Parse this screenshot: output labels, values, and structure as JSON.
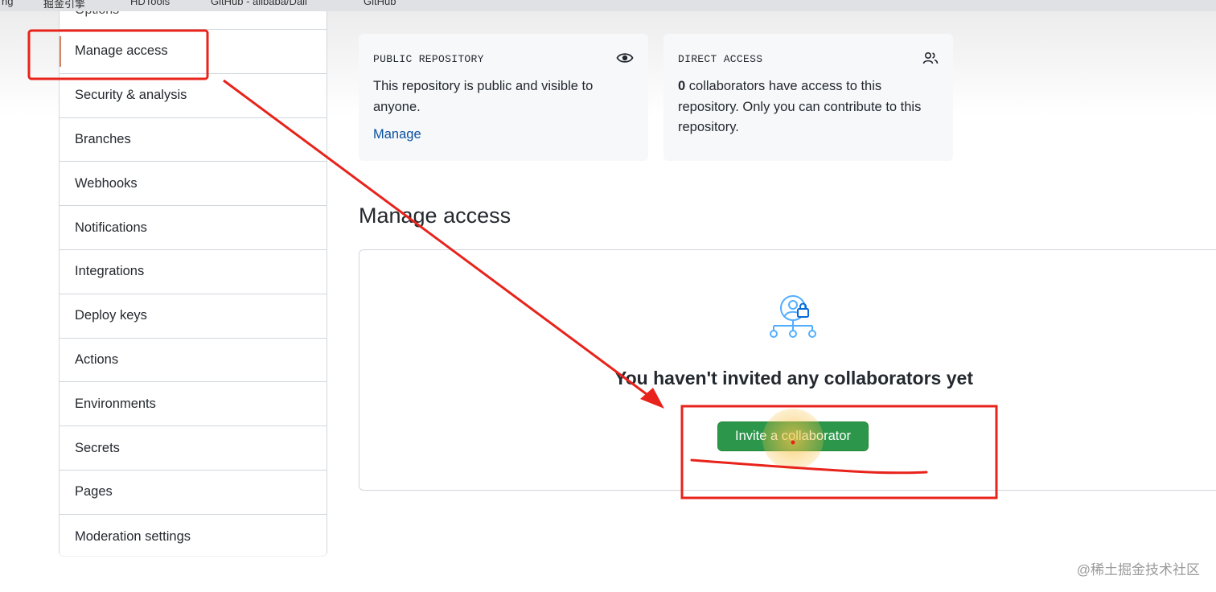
{
  "bookmarks": [
    "ng",
    "掘金引擎",
    "HDTools",
    "GitHub - alibaba/Dali",
    "GitHub"
  ],
  "sidebar": {
    "top_partial": "Options",
    "items": [
      {
        "label": "Manage access"
      },
      {
        "label": "Security & analysis"
      },
      {
        "label": "Branches"
      },
      {
        "label": "Webhooks"
      },
      {
        "label": "Notifications"
      },
      {
        "label": "Integrations"
      },
      {
        "label": "Deploy keys"
      },
      {
        "label": "Actions"
      },
      {
        "label": "Environments"
      },
      {
        "label": "Secrets"
      },
      {
        "label": "Pages"
      },
      {
        "label": "Moderation settings"
      }
    ]
  },
  "public_card": {
    "label": "PUBLIC REPOSITORY",
    "text": "This repository is public and visible to anyone.",
    "link": "Manage",
    "icon": "eye-icon"
  },
  "direct_card": {
    "label": "DIRECT ACCESS",
    "count": "0",
    "text": " collaborators have access to this repository. Only you can contribute to this repository.",
    "icon": "people-icon"
  },
  "main": {
    "title": "Manage access",
    "blank_title": "You haven't invited any collaborators yet",
    "invite_button": "Invite a collaborator",
    "blank_icon": "person-lock-icon"
  },
  "annotations": {
    "color": "#e8231b",
    "highlight": "#f7c34a"
  },
  "watermark": "@稀土掘金技术社区"
}
